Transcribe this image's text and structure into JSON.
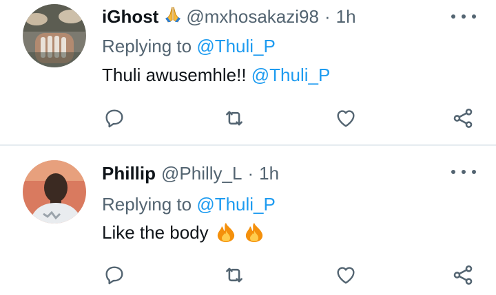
{
  "tweets": [
    {
      "name": "iGhost",
      "name_emoji": "praying-hands-emoji",
      "handle": "@mxhosakazi98",
      "separator": "·",
      "time": "1h",
      "replying_label": "Replying to",
      "replying_to": "@Thuli_P",
      "text": "Thuli awusemhle!!",
      "text_mention": "@Thuli_P"
    },
    {
      "name": "Phillip",
      "handle": "@Philly_L",
      "separator": "·",
      "time": "1h",
      "replying_label": "Replying to",
      "replying_to": "@Thuli_P",
      "text": "Like the body",
      "text_emojis": [
        "fire-emoji",
        "fire-emoji"
      ]
    }
  ],
  "colors": {
    "text": "#0f1419",
    "secondary": "#536471",
    "accent": "#1d9bf0",
    "divider": "#e6ecf0"
  },
  "icons": [
    "reply-icon",
    "retweet-icon",
    "like-icon",
    "share-icon",
    "more-icon"
  ]
}
